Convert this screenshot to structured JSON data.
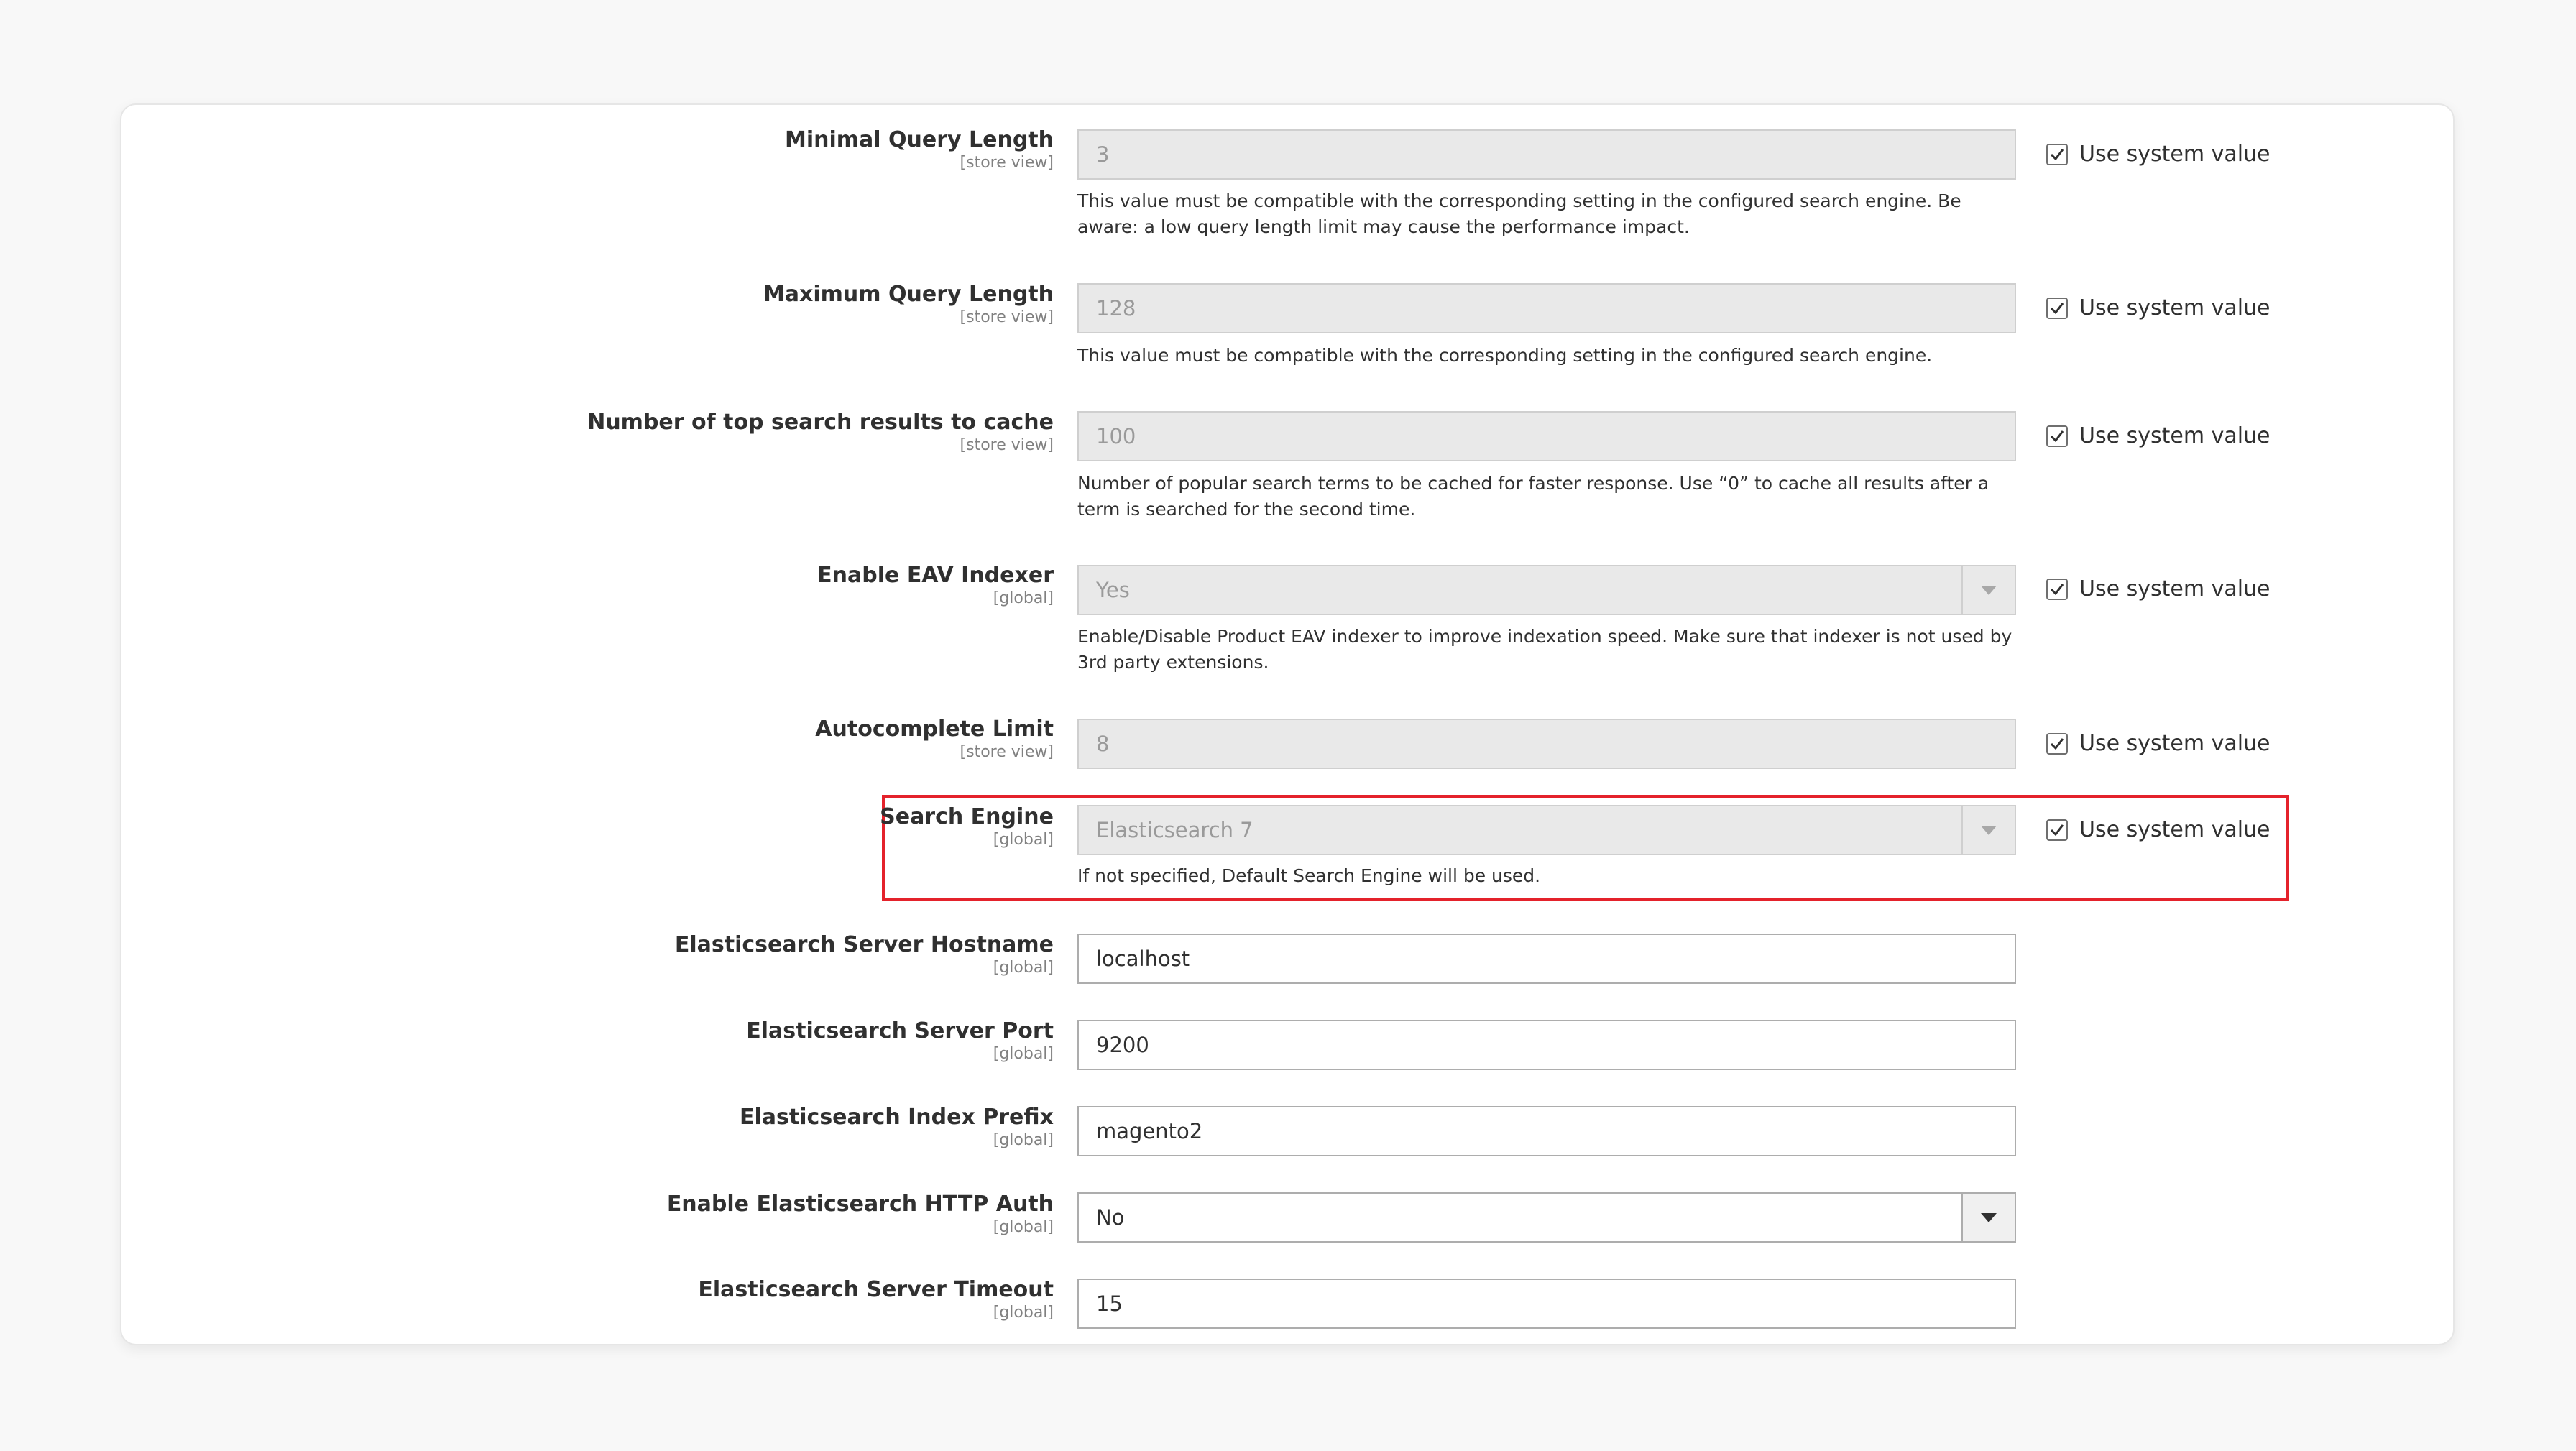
{
  "fields": [
    {
      "label": "Minimal Query Length",
      "scope": "[store view]",
      "value": "3",
      "type": "text",
      "disabled": true,
      "use_system_value": "Use system value",
      "note": "This value must be compatible with the corresponding setting in the configured search engine. Be aware: a low query length limit may cause the performance impact."
    },
    {
      "label": "Maximum Query Length",
      "scope": "[store view]",
      "value": "128",
      "type": "text",
      "disabled": true,
      "use_system_value": "Use system value",
      "note": "This value must be compatible with the corresponding setting in the configured search engine."
    },
    {
      "label": "Number of top search results to cache",
      "scope": "[store view]",
      "value": "100",
      "type": "text",
      "disabled": true,
      "use_system_value": "Use system value",
      "note": "Number of popular search terms to be cached for faster response. Use “0” to cache all results after a term is searched for the second time."
    },
    {
      "label": "Enable EAV Indexer",
      "scope": "[global]",
      "value": "Yes",
      "type": "select",
      "disabled": true,
      "use_system_value": "Use system value",
      "note": "Enable/Disable Product EAV indexer to improve indexation speed. Make sure that indexer is not used by 3rd party extensions."
    },
    {
      "label": "Autocomplete Limit",
      "scope": "[store view]",
      "value": "8",
      "type": "text",
      "disabled": true,
      "use_system_value": "Use system value",
      "note": ""
    },
    {
      "label": "Search Engine",
      "scope": "[global]",
      "value": "Elasticsearch 7",
      "type": "select",
      "disabled": true,
      "use_system_value": "Use system value",
      "note": "If not specified, Default Search Engine will be used."
    },
    {
      "label": "Elasticsearch Server Hostname",
      "scope": "[global]",
      "value": "localhost",
      "type": "text",
      "disabled": false
    },
    {
      "label": "Elasticsearch Server Port",
      "scope": "[global]",
      "value": "9200",
      "type": "text",
      "disabled": false
    },
    {
      "label": "Elasticsearch Index Prefix",
      "scope": "[global]",
      "value": "magento2",
      "type": "text",
      "disabled": false
    },
    {
      "label": "Enable Elasticsearch HTTP Auth",
      "scope": "[global]",
      "value": "No",
      "type": "select",
      "disabled": false
    },
    {
      "label": "Elasticsearch Server Timeout",
      "scope": "[global]",
      "value": "15",
      "type": "text",
      "disabled": false
    }
  ],
  "highlight_color": "#e4222b"
}
